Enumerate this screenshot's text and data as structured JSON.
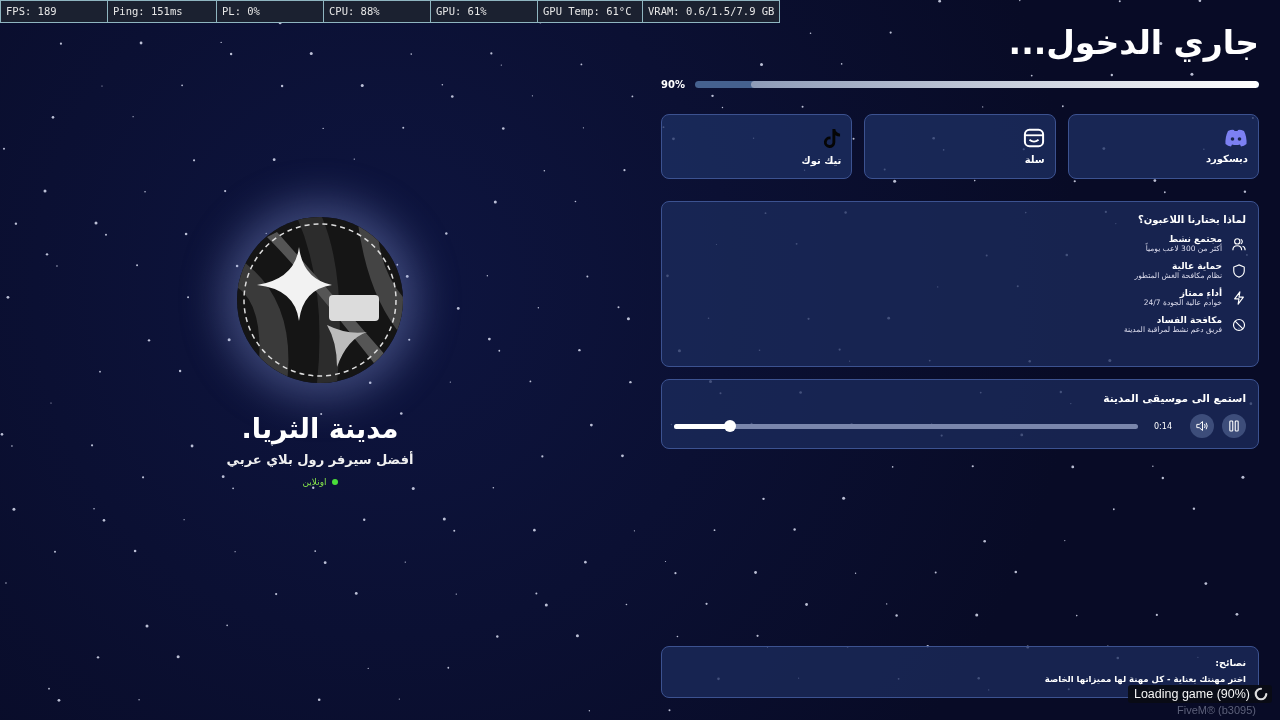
{
  "stats_bar": {
    "fps": "FPS: 189",
    "ping": "Ping: 151ms",
    "packet_loss": "PL: 0%",
    "cpu": "CPU: 88%",
    "gpu": "GPU: 61%",
    "gpu_temp": "GPU Temp: 61°C",
    "vram": "VRAM: 0.6/1.5/7.9 GB"
  },
  "server": {
    "name": "مدينة الثريا.",
    "tagline": "أفضل سيرفر رول بلاي عربي",
    "status": {
      "label": "اونلاين",
      "online": true
    }
  },
  "loading": {
    "title": "جاري الدخول...",
    "percent": "90%",
    "level": 0.9
  },
  "links": [
    {
      "kind": "discord",
      "label": "ديسكورد"
    },
    {
      "kind": "basket",
      "label": "سلة"
    },
    {
      "kind": "tiktok",
      "label": "تيك توك"
    }
  ],
  "features": {
    "title": "لماذا يختارنا اللاعبون؟",
    "items": [
      {
        "kind": "users",
        "title": "مجتمع نشط",
        "description": "أكثر من 300 لاعب يومياً"
      },
      {
        "kind": "shield",
        "title": "حماية عالية",
        "description": "نظام مكافحة الغش المتطور"
      },
      {
        "kind": "bolt",
        "title": "أداء ممتاز",
        "description": "خوادم عالية الجودة 24/7"
      },
      {
        "kind": "ban",
        "title": "مكافحة الفساد",
        "description": "فريق دعم نشط لمراقبة المدينة"
      }
    ]
  },
  "music": {
    "title": "استمع الى موسيقى المدينة",
    "time": "0:14",
    "playing": true,
    "level": 0.12
  },
  "tips": {
    "title": "نصائح:",
    "text": "اختر مهنتك بعناية - كل مهنة لها مميزاتها الخاصة"
  },
  "game_status": {
    "message": "Loading game (90%)",
    "build": "FiveM® (b3095)"
  }
}
